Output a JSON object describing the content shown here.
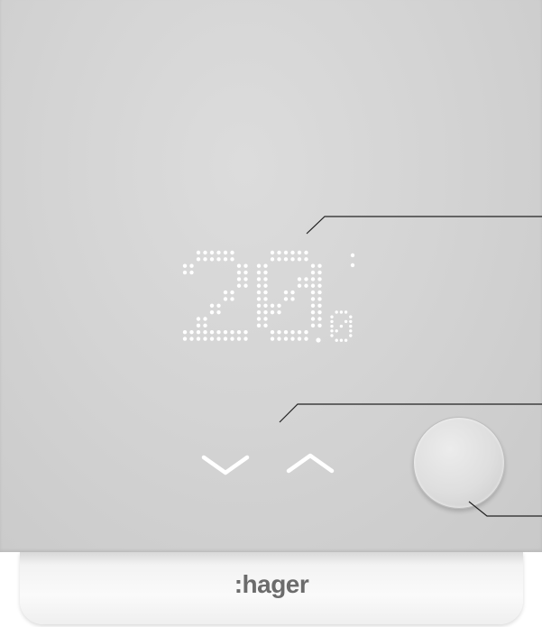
{
  "display": {
    "temperature_main": "20",
    "temperature_decimal": "0",
    "dot_color": "#ffffff"
  },
  "controls": {
    "down_icon": "chevron-down-icon",
    "up_icon": "chevron-up-icon",
    "knob_icon": "round-button"
  },
  "brand": {
    "logo_text": ":hager",
    "color": "#6c6c6c"
  },
  "colors": {
    "panel": "#d4d4d4",
    "base": "#f5f5f5",
    "callout_line": "#222222"
  }
}
